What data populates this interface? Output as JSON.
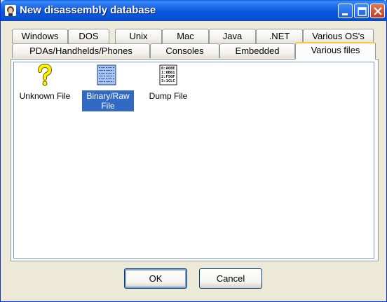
{
  "window": {
    "title": "New disassembly database",
    "app_icon": "ida-icon",
    "controls": [
      "minimize-icon",
      "maximize-icon",
      "close-icon"
    ]
  },
  "tabs": {
    "row1": [
      "Windows",
      "DOS",
      "Unix",
      "Mac",
      "Java",
      ".NET",
      "Various OS's"
    ],
    "row2": [
      "PDAs/Handhelds/Phones",
      "Consoles",
      "Embedded",
      "Various files"
    ],
    "active": "Various files"
  },
  "items": [
    {
      "label": "Unknown File",
      "icon": "question-mark-icon",
      "selected": false
    },
    {
      "label": "Binary/Raw File",
      "label_line1": "Binary/Raw",
      "label_line2": "File",
      "icon": "binary-file-icon",
      "selected": true
    },
    {
      "label": "Dump File",
      "icon": "dump-file-icon",
      "selected": false
    }
  ],
  "buttons": {
    "ok": "OK",
    "cancel": "Cancel"
  },
  "colors": {
    "selection": "#316AC5",
    "titlebar": "#0A58E0",
    "active_tab_accent": "#FFC83C",
    "dialog_bg": "#ECE9D8"
  }
}
